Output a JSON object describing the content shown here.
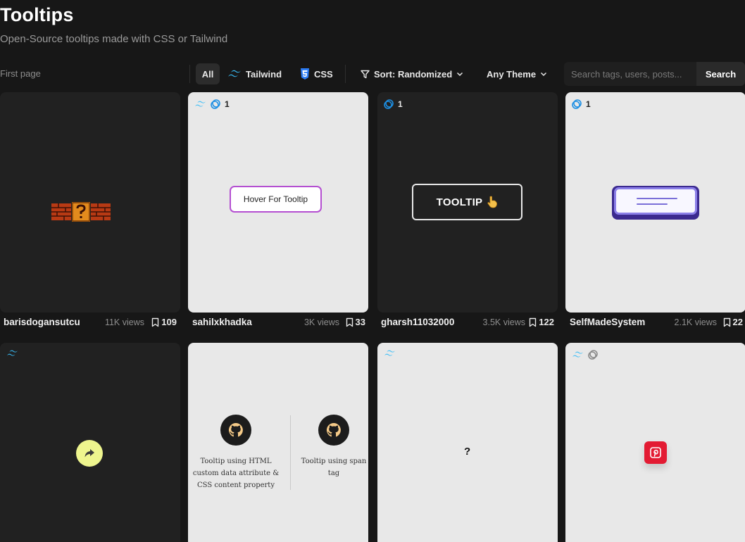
{
  "header": {
    "title": "Tooltips",
    "subtitle": "Open-Source tooltips made with CSS or Tailwind"
  },
  "toolbar": {
    "first_page": "First page",
    "filter_all": "All",
    "filter_tailwind": "Tailwind",
    "filter_css": "CSS",
    "sort_label": "Sort: Randomized",
    "theme_label": "Any Theme",
    "search_placeholder": "Search tags, users, posts...",
    "search_button": "Search"
  },
  "colors": {
    "background": "#171717",
    "tailwind_icon": "#38bdf8",
    "css_icon": "#2d7ef7",
    "accent_purple": "#b44fd1",
    "pinterest": "#e31b33"
  },
  "cards": [
    {
      "user": "barisdogansutcu",
      "views": "11K views",
      "saves": "109",
      "theme": "dark",
      "preview": "mario-question-block"
    },
    {
      "user": "sahilxkhadka",
      "views": "3K views",
      "saves": "33",
      "theme": "light",
      "icons": [
        "tailwind-icon",
        "variants-icon"
      ],
      "variants": "1",
      "preview_text": "Hover For Tooltip"
    },
    {
      "user": "gharsh11032000",
      "views": "3.5K views",
      "saves": "122",
      "theme": "dark",
      "icons": [
        "variants-icon"
      ],
      "variants": "1",
      "preview_text": "TOOLTIP"
    },
    {
      "user": "SelfMadeSystem",
      "views": "2.1K views",
      "saves": "22",
      "theme": "light",
      "icons": [
        "variants-icon"
      ],
      "variants": "1",
      "preview": "purple-box"
    },
    {
      "theme": "dark",
      "icons": [
        "tailwind-icon"
      ],
      "preview": "share-circle"
    },
    {
      "theme": "light",
      "preview": "github-tooltips",
      "captions": [
        "Tooltip using HTML custom data attribute & CSS content property",
        "Tooltip using span tag"
      ]
    },
    {
      "theme": "light",
      "icons": [
        "tailwind-icon"
      ],
      "preview_text": "?"
    },
    {
      "theme": "light",
      "icons": [
        "tailwind-icon",
        "variants-icon"
      ],
      "preview": "pinterest-button"
    }
  ]
}
